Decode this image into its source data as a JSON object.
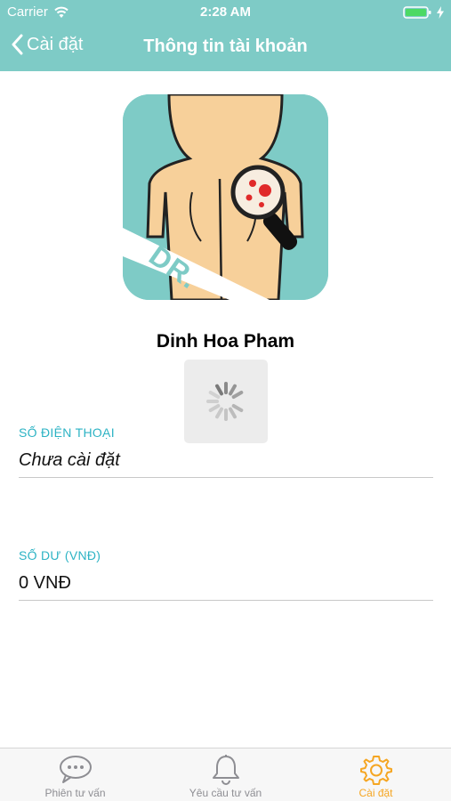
{
  "status_bar": {
    "carrier": "Carrier",
    "time": "2:28 AM"
  },
  "nav": {
    "back_label": "Cài đặt",
    "title": "Thông tin tài khoản"
  },
  "profile": {
    "avatar_text": "DR.",
    "name": "Dinh Hoa Pham"
  },
  "fields": [
    {
      "label": "SỐ ĐIỆN THOẠI",
      "value": "Chưa cài đặt"
    },
    {
      "label": "SỐ DƯ (VNĐ)",
      "value": "0 VNĐ"
    }
  ],
  "tabs": [
    {
      "label": "Phiên tư vấn",
      "icon": "chat-bubble-icon"
    },
    {
      "label": "Yêu cầu tư vấn",
      "icon": "bell-icon"
    },
    {
      "label": "Cài đặt",
      "icon": "gear-icon",
      "active": true
    }
  ],
  "colors": {
    "header": "#7ecbc6",
    "accent_label": "#2cb3c4",
    "active_tab": "#f5a623",
    "inactive_tab": "#8e8e93"
  }
}
